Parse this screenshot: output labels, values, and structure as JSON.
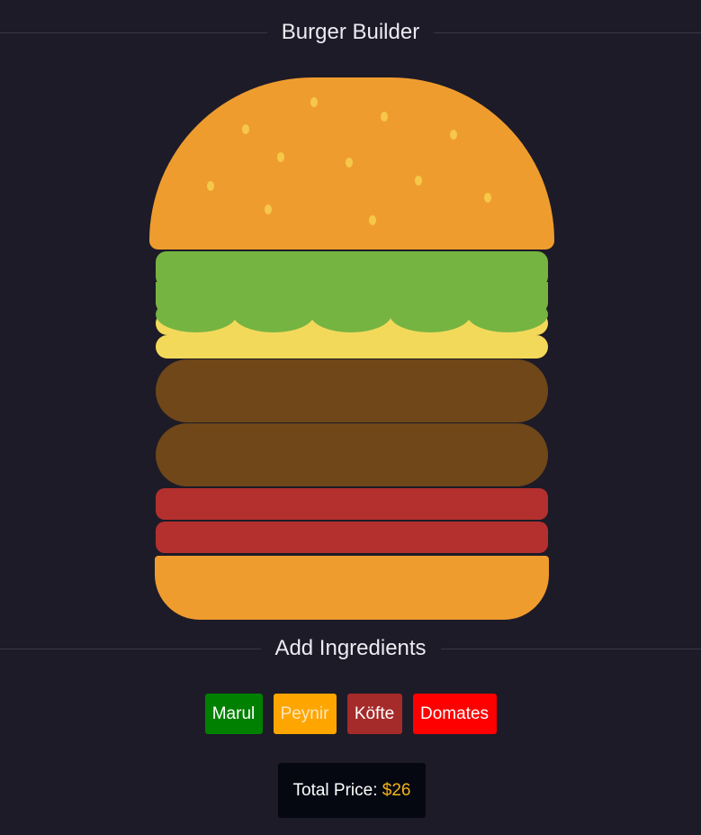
{
  "header": {
    "title": "Burger Builder"
  },
  "ingredients_section": {
    "title": "Add Ingredients"
  },
  "burger": {
    "layers": [
      "bun-top",
      "lettuce",
      "lettuce",
      "cheese",
      "cheese",
      "patty",
      "patty",
      "tomato",
      "tomato",
      "bun-bottom"
    ]
  },
  "buttons": [
    {
      "label": "Marul",
      "color": "#008000"
    },
    {
      "label": "Peynir",
      "color": "#ffa500"
    },
    {
      "label": "Köfte",
      "color": "#a52a2a"
    },
    {
      "label": "Domates",
      "color": "#ff0000"
    }
  ],
  "price": {
    "label": "Total Price:",
    "value": "$26"
  },
  "colors": {
    "background": "#1d1b27",
    "bun": "#ef9c2f",
    "lettuce": "#76b442",
    "cheese": "#f3d95a",
    "patty": "#6f4719",
    "tomato": "#b3302e",
    "price_accent": "#f5b31a"
  }
}
